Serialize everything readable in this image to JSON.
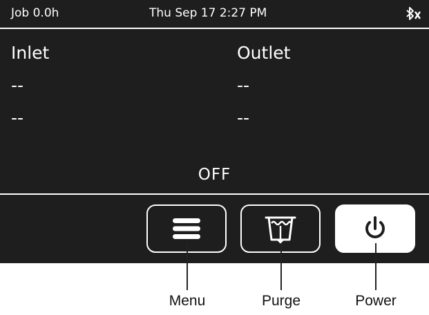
{
  "status_bar": {
    "job": "Job 0.0h",
    "datetime": "Thu Sep 17  2:27 PM",
    "bluetooth_icon": "bluetooth-disconnected-icon"
  },
  "inlet": {
    "title": "Inlet",
    "value1": "--",
    "value2": "--"
  },
  "outlet": {
    "title": "Outlet",
    "value1": "--",
    "value2": "--"
  },
  "state_label": "OFF",
  "buttons": {
    "menu": {
      "icon": "hamburger-menu-icon"
    },
    "purge": {
      "icon": "purge-bucket-icon"
    },
    "power": {
      "icon": "power-icon"
    }
  },
  "callouts": {
    "menu": "Menu",
    "purge": "Purge",
    "power": "Power"
  },
  "colors": {
    "screen_bg": "#1e1e1e",
    "foreground": "#ffffff",
    "callout_text": "#111111"
  }
}
